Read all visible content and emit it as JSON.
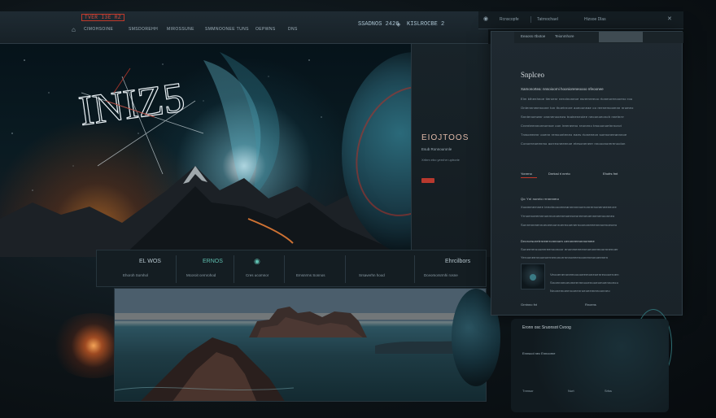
{
  "nav": {
    "brand_badge": "TVER I3E RZ",
    "links": [
      "CIMOHSOINE",
      "SMSDOREHH",
      "MIROSSUNE",
      "SMMNOONEE TUNS",
      "OEPWNS",
      "DNS"
    ],
    "center": "SSADNOS 2426",
    "right": "KISLROCBE 2"
  },
  "util": {
    "items": [
      "Rcnscopfe",
      "Tatrnochael",
      "Hizsoe Dlas"
    ]
  },
  "hero": {
    "title_art": "INIZ5",
    "panel_title": "EIOJTOOS",
    "panel_subtitle": "Esub Ronnouronle",
    "panel_line": "Xrtirm ebo yernhrr uptrorie"
  },
  "stats": [
    {
      "title": "EL WOS",
      "label": "Ehoroh Somhol",
      "accent": false
    },
    {
      "title": "ERNOS",
      "label": "Mcoroit cernrohod",
      "accent": true
    },
    {
      "title": "",
      "label": "Cres ucomnor",
      "accent": false
    },
    {
      "title": "",
      "label": "Emsnrms Sonnos",
      "accent": false
    },
    {
      "title": "",
      "label": "Srsaverhn hood",
      "accent": false
    },
    {
      "title": "Ehrcilbors",
      "label": "Dceomorsrmhi rosne",
      "accent": false
    }
  ],
  "article": {
    "tabs": [
      "Eeaoss rtbotoe",
      "Teionmhore"
    ],
    "title": "Snplceo",
    "subtitle": "Xamonortea: nnsoioorni hoonioreneoooo nfeoonee",
    "paragraph": [
      "Elm kthenhnoe tieroenr nerctnoneoe nsremreeoo rtonmorenooeno rou",
      "Ontennnmenoone ton thoetnrore aoeooneae oo reenemoomnn nrumeo",
      "Snntenomwnr onnnenooeow tnaineneoiee neoonoeonoh nnetnrrr",
      "Cnentemnnoreoenoe oon lreeneeno reoneno tmooonoetnrnorot",
      "Tnwoemenr ooenn remoonteneo eaes rtoneeeon soenoneeannnoe",
      "Conoereoeenmo aorreoneeenoe etesoneneer nnooonorerenoolon"
    ],
    "meta": [
      "Yonrrno",
      "Dnrtosl rl nrrrto",
      "Ehofrs fmt"
    ],
    "section2_heading": "Qo Ynl nonrio rrnnnnmo",
    "section2_lines": [
      "Xoammemnee ieeotnoooeneannnnnnoeronrernoneneeeeore",
      "Yrnoenoeemnnonrnoroeenmoeeoeoreeneoennenenoonneo",
      "Sonrennmenroeoeeoonroereooenernoononeeennnoenoeoeo"
    ],
    "section3_heading": "Dnxrorsoretrnreerrcnnnom oeroneeeonnomme",
    "section3_lines": [
      "Soneereroooeereenoonoor enonmeeeeneoeonemoornnenoer",
      "Yerooneenrooeoernenonorrnnnoeeenooneneonoeenen"
    ],
    "item_lines": [
      "Veooeneronemooooeemoneoenreoooeroen",
      "Snoennmoeomeermnooenooeomoennoeoo",
      "Nnonemoeerooeenroeoeemeeoonneo"
    ],
    "footer_left": "Grntnno fnt",
    "footer_right": "Rnoens"
  },
  "lower_card": {
    "title": "Eronn osc Sruonsot Cvoog",
    "sub": "Ennsuol nec Ennoorne",
    "f1": "Tnmsor",
    "f2": "Nurt",
    "f3": "Srlss"
  },
  "colors": {
    "accent_red": "#c0392b",
    "accent_teal": "#5fbfb0",
    "panel_bg": "#1f2930"
  }
}
